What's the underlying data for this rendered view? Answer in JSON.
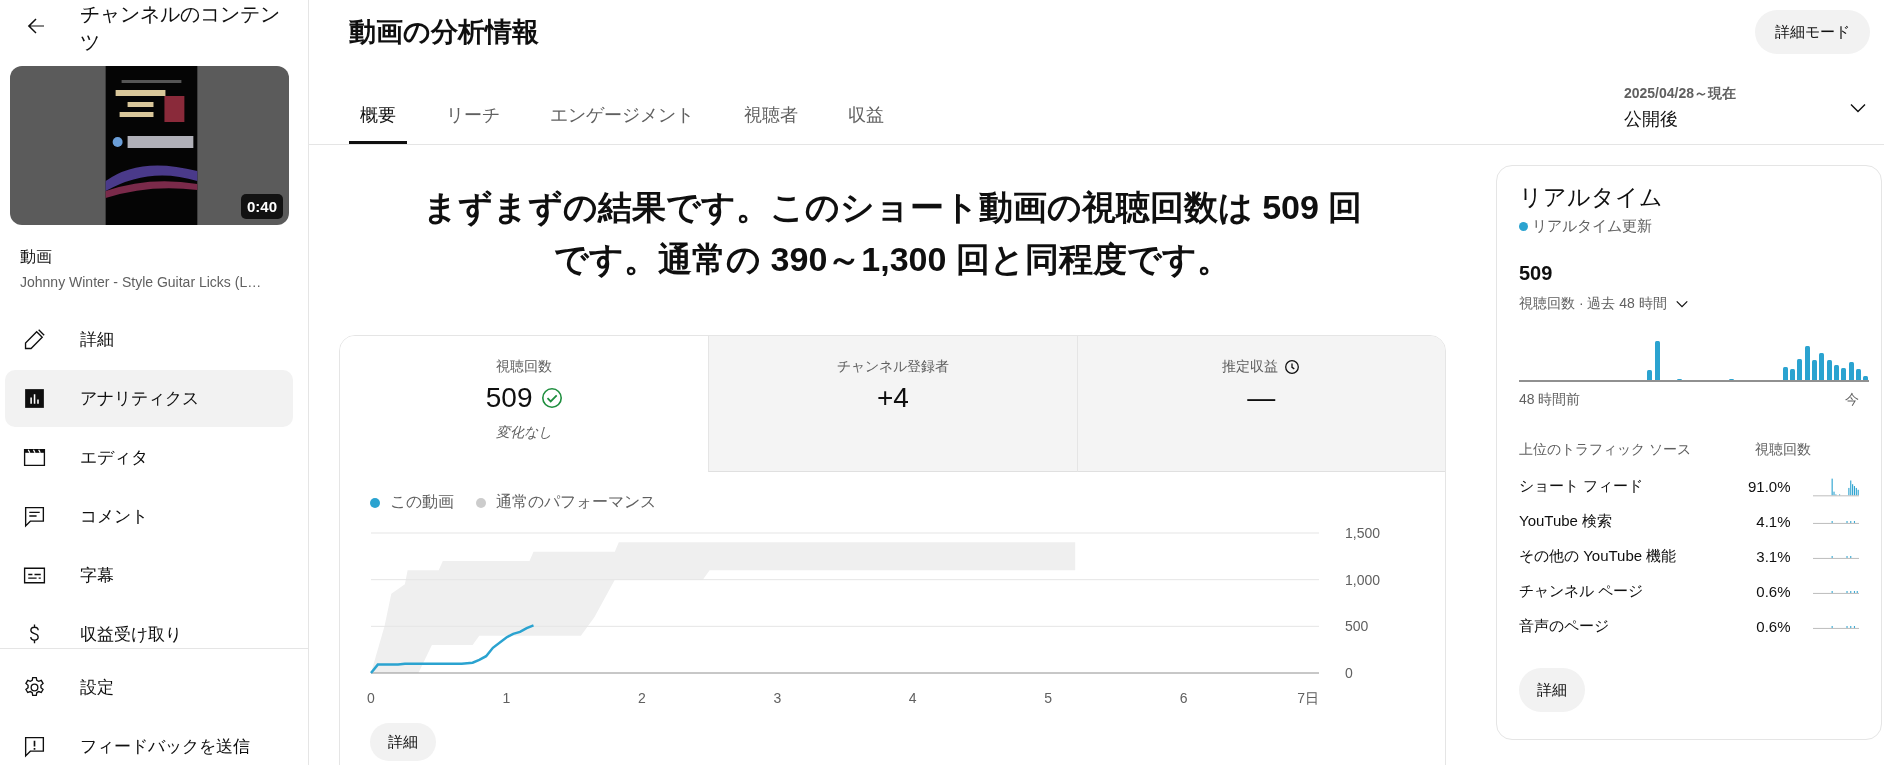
{
  "sidebar": {
    "back_title": "チャンネルのコンテンツ",
    "thumbnail": {
      "kind": "picture",
      "duration": "0:40"
    },
    "video_label": "動画",
    "video_title": "Johnny Winter - Style Guitar Licks (L…",
    "nav": [
      {
        "label": "詳細",
        "selected": false
      },
      {
        "label": "アナリティクス",
        "selected": true
      },
      {
        "label": "エディタ",
        "selected": false
      },
      {
        "label": "コメント",
        "selected": false
      },
      {
        "label": "字幕",
        "selected": false
      },
      {
        "label": "収益受け取り",
        "selected": false
      }
    ],
    "footer": [
      {
        "label": "設定"
      },
      {
        "label": "フィードバックを送信"
      }
    ]
  },
  "page": {
    "title": "動画の分析情報",
    "mode_button": "詳細モード",
    "tabs": [
      {
        "label": "概要",
        "selected": true
      },
      {
        "label": "リーチ",
        "selected": false
      },
      {
        "label": "エンゲージメント",
        "selected": false
      },
      {
        "label": "視聴者",
        "selected": false
      },
      {
        "label": "収益",
        "selected": false
      }
    ],
    "date_range": {
      "range": "2025/04/28～現在",
      "label": "公開後"
    }
  },
  "summary": "まずまずの結果です。このショート動画の視聴回数は 509 回です。通常の 390～1,300 回と同程度です。",
  "overview_card": {
    "metrics": [
      {
        "kind": "views",
        "label": "視聴回数",
        "value": "509",
        "note": "変化なし",
        "selected": true
      },
      {
        "kind": "plain",
        "label": "チャンネル登録者",
        "value": "+4",
        "selected": false
      },
      {
        "kind": "estimate",
        "label": "推定収益",
        "value": "—",
        "selected": false
      }
    ],
    "chart_data": {
      "type": "line",
      "xlim": [
        0,
        7
      ],
      "ylim": [
        0,
        1500
      ],
      "xticks": [
        0,
        1,
        2,
        3,
        4,
        5,
        6,
        {
          "value": 7,
          "label": "7日"
        }
      ],
      "yticks": [
        0,
        500,
        {
          "value": 1000,
          "label": "1,000"
        },
        {
          "value": 1500,
          "label": "1,500"
        }
      ],
      "x": [
        0,
        0.05,
        0.2,
        0.25,
        0.5,
        0.67,
        0.75,
        0.8,
        0.85,
        0.9,
        1.0,
        1.05,
        1.1,
        1.15,
        1.2
      ],
      "series": [
        {
          "name": "この動画",
          "color": "#2ba3d0",
          "values": [
            0,
            90,
            90,
            100,
            100,
            100,
            110,
            140,
            180,
            270,
            380,
            420,
            440,
            480,
            510
          ]
        }
      ]
    },
    "typical_range": {
      "name": "通常のパフォーマンス",
      "color": "#cccccc"
    },
    "details_button": "詳細"
  },
  "realtime": {
    "title": "リアルタイム",
    "live_label": "リアルタイム更新",
    "count": "509",
    "metric_select": "視聴回数 · 過去 48 時間",
    "axis_start": "48 時間前",
    "axis_end": "今",
    "columns": [
      "上位のトラフィック ソース",
      "視聴回数"
    ],
    "rows": [
      {
        "source": "ショート フィード",
        "share": "91.0%"
      },
      {
        "source": "YouTube 検索",
        "share": "4.1%"
      },
      {
        "source": "その他の YouTube 機能",
        "share": "3.1%"
      },
      {
        "source": "チャンネル ページ",
        "share": "0.6%"
      },
      {
        "source": "音声のページ",
        "share": "0.6%"
      }
    ],
    "details_button": "詳細"
  }
}
